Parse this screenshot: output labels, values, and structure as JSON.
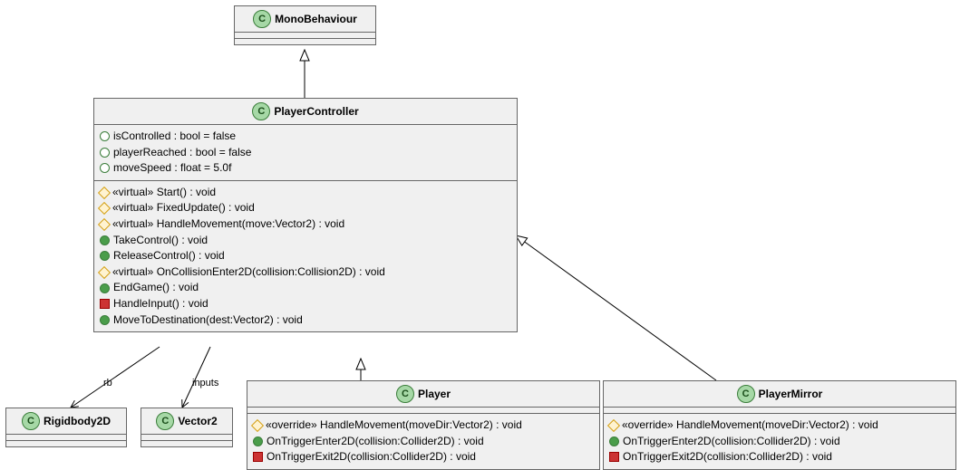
{
  "classes": {
    "monoBehaviour": {
      "name": "MonoBehaviour"
    },
    "playerController": {
      "name": "PlayerController",
      "fields": [
        {
          "vis": "circle-open",
          "text": "isControlled : bool = false"
        },
        {
          "vis": "circle-open",
          "text": "playerReached : bool = false"
        },
        {
          "vis": "circle-open",
          "text": "moveSpeed : float = 5.0f"
        }
      ],
      "methods": [
        {
          "vis": "diamond",
          "text": "«virtual» Start() : void"
        },
        {
          "vis": "diamond",
          "text": "«virtual» FixedUpdate() : void"
        },
        {
          "vis": "diamond",
          "text": "«virtual» HandleMovement(move:Vector2) : void"
        },
        {
          "vis": "circle-filled",
          "text": "TakeControl() : void"
        },
        {
          "vis": "circle-filled",
          "text": "ReleaseControl() : void"
        },
        {
          "vis": "diamond",
          "text": "«virtual» OnCollisionEnter2D(collision:Collision2D) : void"
        },
        {
          "vis": "circle-filled",
          "text": "EndGame() : void"
        },
        {
          "vis": "square",
          "text": "HandleInput() : void"
        },
        {
          "vis": "circle-filled",
          "text": "MoveToDestination(dest:Vector2) : void"
        }
      ]
    },
    "rigidbody2D": {
      "name": "Rigidbody2D"
    },
    "vector2": {
      "name": "Vector2"
    },
    "player": {
      "name": "Player",
      "methods": [
        {
          "vis": "diamond",
          "text": "«override» HandleMovement(moveDir:Vector2) : void"
        },
        {
          "vis": "circle-filled",
          "text": "OnTriggerEnter2D(collision:Collider2D) : void"
        },
        {
          "vis": "square",
          "text": "OnTriggerExit2D(collision:Collider2D) : void"
        }
      ]
    },
    "playerMirror": {
      "name": "PlayerMirror",
      "methods": [
        {
          "vis": "diamond",
          "text": "«override» HandleMovement(moveDir:Vector2) : void"
        },
        {
          "vis": "circle-filled",
          "text": "OnTriggerEnter2D(collision:Collider2D) : void"
        },
        {
          "vis": "square",
          "text": "OnTriggerExit2D(collision:Collider2D) : void"
        }
      ]
    }
  },
  "edgeLabels": {
    "rb": "rb",
    "inputs": "inputs"
  },
  "badge": "C"
}
